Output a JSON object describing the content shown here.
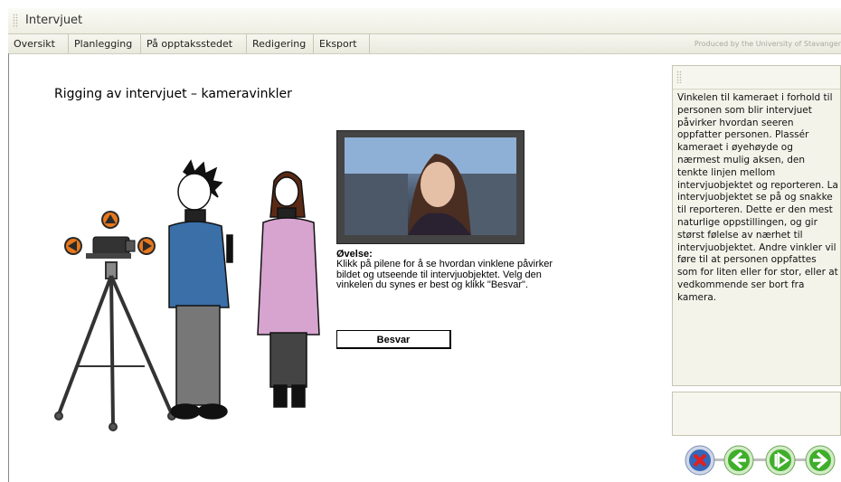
{
  "window": {
    "title": "Intervjuet"
  },
  "menu": {
    "items": [
      {
        "label": "Oversikt"
      },
      {
        "label": "Planlegging"
      },
      {
        "label": "På opptaksstedet"
      },
      {
        "label": "Redigering"
      },
      {
        "label": "Eksport"
      }
    ],
    "credit": "Produced by the University of Stavanger"
  },
  "main": {
    "title": "Rigging av intervjuet – kameravinkler",
    "exercise_heading": "Øvelse:",
    "exercise_text": "Klikk på pilene for å se hvordan vinklene påvirker bildet og utseende til intervjuobjektet. Velg den vinkelen du synes er best og klikk \"Besvar\".",
    "answer_button": "Besvar"
  },
  "side_panel": {
    "text": "Vinkelen til kameraet i forhold til personen som blir intervjuet påvirker hvordan seeren oppfatter personen. Plassér kameraet i øyehøyde og nærmest mulig aksen, den tenkte linjen mellom intervjuobjektet og reporteren. La intervjuobjektet se på og snakke til reporteren. Dette er den mest naturlige oppstillingen, og gir størst følelse av nærhet til intervjuobjektet. Andre vinkler vil føre til at personen oppfattes som for liten eller for stor, eller at vedkommende ser bort fra kamera."
  },
  "icons": {
    "camera_arrows": [
      "arrow-up-icon",
      "arrow-left-icon",
      "arrow-right-icon"
    ],
    "nav": [
      "close-icon",
      "back-icon",
      "play-icon",
      "forward-icon"
    ]
  },
  "colors": {
    "arrow_orange": "#e8781c",
    "nav_green": "#3fae2a",
    "nav_close_blue": "#3568b8",
    "close_red": "#e02020"
  }
}
